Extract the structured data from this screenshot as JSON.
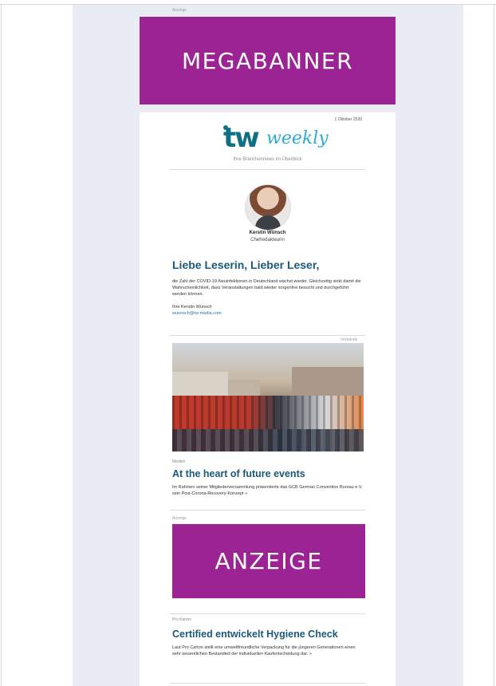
{
  "top_label": "Anzeige",
  "megabanner": {
    "label": "MEGABANNER"
  },
  "newsletter": {
    "date": "1 Oktober 2020",
    "logo": {
      "tw": "tw",
      "weekly": "weekly"
    },
    "tagline": "Ihre Branchennews im Überblick",
    "author": {
      "name": "Kerstin Wünsch",
      "role": "Chefredakteurin"
    },
    "intro": {
      "salutation": "Liebe Leserin, Lieber Leser,",
      "text": "die Zahl der COVID-19-Neuinfektionen in Deutschland wächst wieder. Gleichzeitig sinkt damit die Wahrscheinlichkeit, dass Veranstaltungen bald wieder sorgenfrei besucht und durchgeführt werden können.",
      "signoff": "Ihre Kerstin Wünsch",
      "email": "wuensch@tw-media.com"
    },
    "photo_label": "Verbände",
    "article1": {
      "kicker": "Medien",
      "headline": "At the heart of future events",
      "teaser": "Im Rahmen seiner Mitgliederversammlung präsentierte das GCB German Convention Bureau e.V. sein Post-Corona-Recovery-Konzept  »"
    },
    "ad_label": "Anzeige",
    "ad": {
      "label": "ANZEIGE"
    },
    "article2": {
      "kicker": "Pro Karton",
      "headline": "Certified entwickelt Hygiene Check",
      "teaser": "Laut Pro Carton stellt eine umweltfreundliche Verpackung für die jüngeren Generationen einen sehr wesentlichen Bestandteil der individuellen Kaufentscheidung dar.  »"
    }
  },
  "colors": {
    "banner": "#9b2393",
    "headline": "#1a5a78",
    "panel": "#e9ecf2"
  }
}
